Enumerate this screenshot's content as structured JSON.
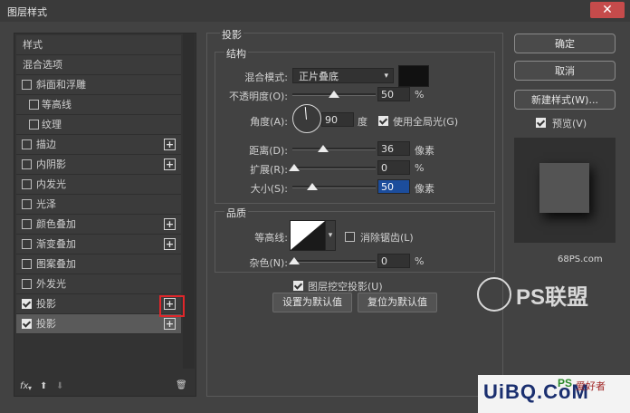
{
  "window": {
    "title": "图层样式"
  },
  "styles_panel": {
    "items": [
      {
        "label": "样式",
        "checkbox": false,
        "checked": false,
        "plus": false
      },
      {
        "label": "混合选项",
        "checkbox": false,
        "checked": false,
        "plus": false
      },
      {
        "label": "斜面和浮雕",
        "checkbox": true,
        "checked": false,
        "plus": false
      },
      {
        "label": "等高线",
        "checkbox": true,
        "checked": false,
        "plus": false,
        "indent": true
      },
      {
        "label": "纹理",
        "checkbox": true,
        "checked": false,
        "plus": false,
        "indent": true
      },
      {
        "label": "描边",
        "checkbox": true,
        "checked": false,
        "plus": true
      },
      {
        "label": "内阴影",
        "checkbox": true,
        "checked": false,
        "plus": true
      },
      {
        "label": "内发光",
        "checkbox": true,
        "checked": false,
        "plus": false
      },
      {
        "label": "光泽",
        "checkbox": true,
        "checked": false,
        "plus": false
      },
      {
        "label": "颜色叠加",
        "checkbox": true,
        "checked": false,
        "plus": true
      },
      {
        "label": "渐变叠加",
        "checkbox": true,
        "checked": false,
        "plus": true
      },
      {
        "label": "图案叠加",
        "checkbox": true,
        "checked": false,
        "plus": false
      },
      {
        "label": "外发光",
        "checkbox": true,
        "checked": false,
        "plus": false
      },
      {
        "label": "投影",
        "checkbox": true,
        "checked": true,
        "plus": true
      },
      {
        "label": "投影",
        "checkbox": true,
        "checked": true,
        "plus": true,
        "selected": true
      }
    ],
    "fx_label": "fx"
  },
  "drop_shadow": {
    "title": "投影",
    "structure": {
      "title": "结构",
      "blend_mode_label": "混合模式:",
      "blend_mode_value": "正片叠底",
      "color": "#111111",
      "opacity_label": "不透明度(O):",
      "opacity_value": "50",
      "opacity_unit": "%",
      "opacity_fraction": 0.5,
      "angle_label": "角度(A):",
      "angle_value": "90",
      "angle_unit": "度",
      "global_light_label": "使用全局光(G)",
      "global_light_checked": true,
      "distance_label": "距离(D):",
      "distance_value": "36",
      "distance_unit": "像素",
      "spread_label": "扩展(R):",
      "spread_value": "0",
      "spread_unit": "%",
      "size_label": "大小(S):",
      "size_value": "50",
      "size_unit": "像素"
    },
    "quality": {
      "title": "品质",
      "contour_label": "等高线:",
      "anti_alias_label": "消除锯齿(L)",
      "anti_alias_checked": false,
      "noise_label": "杂色(N):",
      "noise_value": "0",
      "noise_unit": "%"
    },
    "knockout_label": "图层挖空投影(U)",
    "knockout_checked": true,
    "make_default_label": "设置为默认值",
    "reset_default_label": "复位为默认值"
  },
  "right_panel": {
    "ok_label": "确定",
    "cancel_label": "取消",
    "new_style_label": "新建样式(W)...",
    "preview_label": "预览(V)",
    "preview_checked": true
  },
  "watermarks": {
    "site1": "68PS.com",
    "brand": "PS联盟",
    "site2": "UiBQ.CoM",
    "badge_ps": "PS",
    "badge_cn": "爱好者"
  },
  "colors": {
    "dialog_bg": "#424242",
    "selected_item": "#5a5a5a",
    "highlight_input": "#1c4d9c",
    "red_annotation": "#e0262a"
  }
}
